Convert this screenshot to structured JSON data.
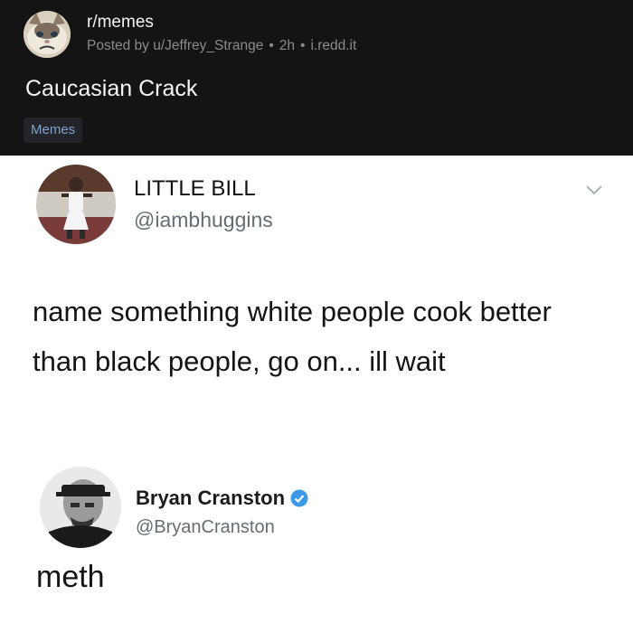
{
  "post": {
    "subreddit": "r/memes",
    "posted_by": "Posted by u/Jeffrey_Strange",
    "age": "2h",
    "domain": "i.redd.it",
    "separator": "•",
    "title": "Caucasian Crack",
    "flair": "Memes"
  },
  "tweets": [
    {
      "display_name": "LITTLE BILL",
      "handle": "@iambhuggins",
      "text": "name something white people cook better than black people, go on... ill wait"
    },
    {
      "display_name": "Bryan Cranston",
      "handle": "@BryanCranston",
      "text": "meth",
      "verified": true
    }
  ],
  "colors": {
    "header_bg": "#141414",
    "flair_text": "#7fa3cf",
    "verified_blue": "#3a99e8",
    "handle_gray": "#656d74"
  },
  "icons": {
    "subreddit_avatar": "grumpy-cat-icon",
    "menu": "chevron-down-icon",
    "verified": "verified-badge-icon"
  }
}
